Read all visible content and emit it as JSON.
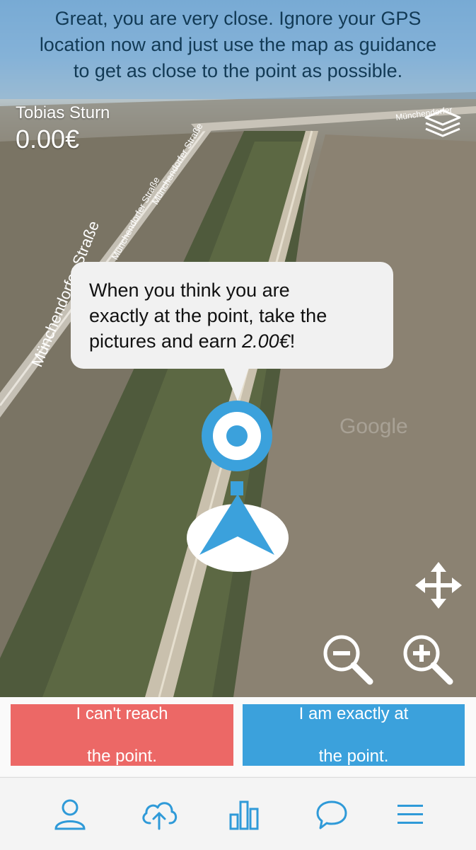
{
  "instruction": {
    "line1": "Great, you are very close. Ignore your GPS",
    "line2": "location now and just use the map as guidance",
    "line3": "to get as close to the point as possible."
  },
  "user": {
    "name": "Tobias Sturn",
    "balance": "0.00€"
  },
  "map": {
    "street_labels": [
      "Münchendorfer Straße",
      "Münchendorfer Straße",
      "Münchendorfer Straße",
      "Münchendorfer"
    ],
    "watermark": "Google"
  },
  "bubble": {
    "line1": "When you think you are",
    "line2": "exactly at the point, take the",
    "line3_prefix": "pictures and earn ",
    "line3_amount": "2.00€",
    "line3_suffix": "!"
  },
  "actions": {
    "cant_reach_line1": "I can't reach",
    "cant_reach_line2": "the point.",
    "exact_line1": "I am exactly at",
    "exact_line2": "the point."
  },
  "nav": {
    "items": [
      "profile-icon",
      "cloud-upload-icon",
      "stats-icon",
      "chat-icon",
      "menu-icon"
    ]
  },
  "colors": {
    "accent_blue": "#3ba1dc",
    "danger_red": "#ec6866",
    "nav_icon_blue": "#2f9ad8"
  }
}
